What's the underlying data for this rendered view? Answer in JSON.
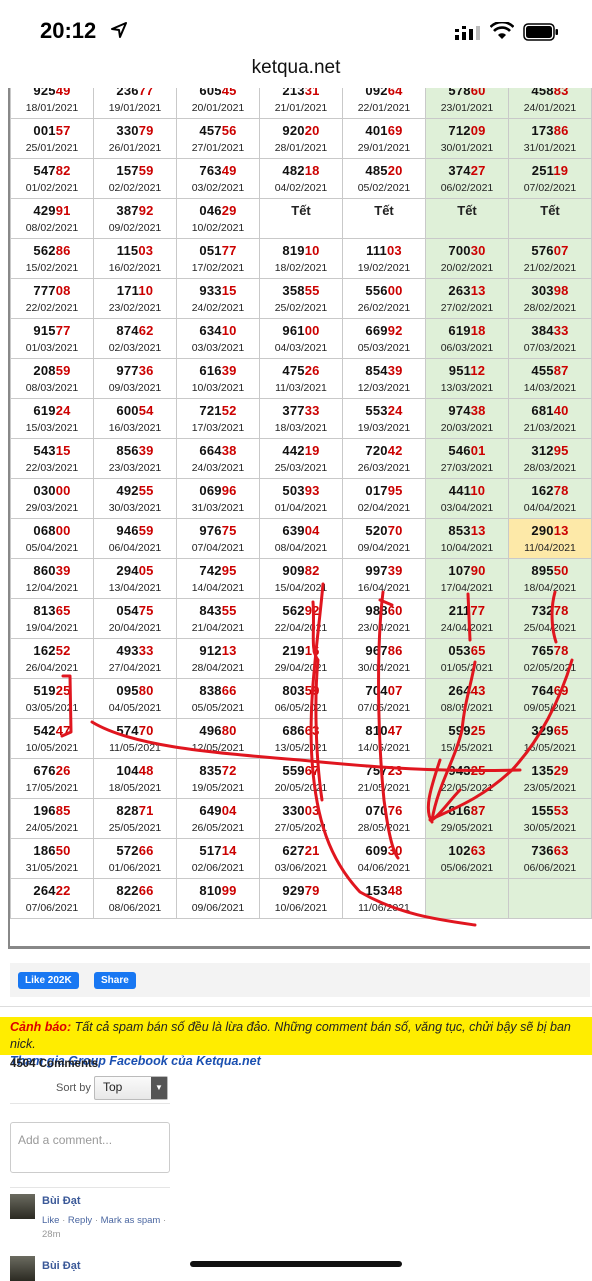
{
  "status_bar": {
    "time": "20:12"
  },
  "browser": {
    "url": "ketqua.net"
  },
  "results_table": {
    "weeks": [
      [
        {
          "num": "92549",
          "date": "18/01/2021"
        },
        {
          "num": "23677",
          "date": "19/01/2021"
        },
        {
          "num": "60545",
          "date": "20/01/2021"
        },
        {
          "num": "21331",
          "date": "21/01/2021"
        },
        {
          "num": "09264",
          "date": "22/01/2021"
        },
        {
          "num": "57860",
          "date": "23/01/2021"
        },
        {
          "num": "45883",
          "date": "24/01/2021"
        }
      ],
      [
        {
          "num": "00157",
          "date": "25/01/2021"
        },
        {
          "num": "33079",
          "date": "26/01/2021"
        },
        {
          "num": "45756",
          "date": "27/01/2021"
        },
        {
          "num": "92020",
          "date": "28/01/2021"
        },
        {
          "num": "40169",
          "date": "29/01/2021"
        },
        {
          "num": "71209",
          "date": "30/01/2021"
        },
        {
          "num": "17386",
          "date": "31/01/2021"
        }
      ],
      [
        {
          "num": "54782",
          "date": "01/02/2021"
        },
        {
          "num": "15759",
          "date": "02/02/2021"
        },
        {
          "num": "76349",
          "date": "03/02/2021"
        },
        {
          "num": "48218",
          "date": "04/02/2021"
        },
        {
          "num": "48520",
          "date": "05/02/2021"
        },
        {
          "num": "37427",
          "date": "06/02/2021"
        },
        {
          "num": "25119",
          "date": "07/02/2021"
        }
      ],
      [
        {
          "num": "42991",
          "date": "08/02/2021"
        },
        {
          "num": "38792",
          "date": "09/02/2021"
        },
        {
          "num": "04629",
          "date": "10/02/2021"
        },
        {
          "tet": "Tết"
        },
        {
          "tet": "Tết"
        },
        {
          "tet": "Tết"
        },
        {
          "tet": "Tết"
        }
      ],
      [
        {
          "num": "56286",
          "date": "15/02/2021"
        },
        {
          "num": "11503",
          "date": "16/02/2021"
        },
        {
          "num": "05177",
          "date": "17/02/2021"
        },
        {
          "num": "81910",
          "date": "18/02/2021"
        },
        {
          "num": "11103",
          "date": "19/02/2021"
        },
        {
          "num": "70030",
          "date": "20/02/2021"
        },
        {
          "num": "57607",
          "date": "21/02/2021"
        }
      ],
      [
        {
          "num": "77708",
          "date": "22/02/2021"
        },
        {
          "num": "17110",
          "date": "23/02/2021"
        },
        {
          "num": "93315",
          "date": "24/02/2021"
        },
        {
          "num": "35855",
          "date": "25/02/2021"
        },
        {
          "num": "55600",
          "date": "26/02/2021"
        },
        {
          "num": "26313",
          "date": "27/02/2021"
        },
        {
          "num": "30398",
          "date": "28/02/2021"
        }
      ],
      [
        {
          "num": "91577",
          "date": "01/03/2021"
        },
        {
          "num": "87462",
          "date": "02/03/2021"
        },
        {
          "num": "63410",
          "date": "03/03/2021"
        },
        {
          "num": "96100",
          "date": "04/03/2021"
        },
        {
          "num": "66992",
          "date": "05/03/2021"
        },
        {
          "num": "61918",
          "date": "06/03/2021"
        },
        {
          "num": "38433",
          "date": "07/03/2021"
        }
      ],
      [
        {
          "num": "20859",
          "date": "08/03/2021"
        },
        {
          "num": "97736",
          "date": "09/03/2021"
        },
        {
          "num": "61639",
          "date": "10/03/2021"
        },
        {
          "num": "47526",
          "date": "11/03/2021"
        },
        {
          "num": "85439",
          "date": "12/03/2021"
        },
        {
          "num": "95112",
          "date": "13/03/2021"
        },
        {
          "num": "45587",
          "date": "14/03/2021"
        }
      ],
      [
        {
          "num": "61924",
          "date": "15/03/2021"
        },
        {
          "num": "60054",
          "date": "16/03/2021"
        },
        {
          "num": "72152",
          "date": "17/03/2021"
        },
        {
          "num": "37733",
          "date": "18/03/2021"
        },
        {
          "num": "55324",
          "date": "19/03/2021"
        },
        {
          "num": "97438",
          "date": "20/03/2021"
        },
        {
          "num": "68140",
          "date": "21/03/2021"
        }
      ],
      [
        {
          "num": "54315",
          "date": "22/03/2021"
        },
        {
          "num": "85639",
          "date": "23/03/2021"
        },
        {
          "num": "66438",
          "date": "24/03/2021"
        },
        {
          "num": "44219",
          "date": "25/03/2021"
        },
        {
          "num": "72042",
          "date": "26/03/2021"
        },
        {
          "num": "54601",
          "date": "27/03/2021"
        },
        {
          "num": "31295",
          "date": "28/03/2021"
        }
      ],
      [
        {
          "num": "03000",
          "date": "29/03/2021"
        },
        {
          "num": "49255",
          "date": "30/03/2021"
        },
        {
          "num": "06996",
          "date": "31/03/2021"
        },
        {
          "num": "50393",
          "date": "01/04/2021"
        },
        {
          "num": "01795",
          "date": "02/04/2021"
        },
        {
          "num": "44110",
          "date": "03/04/2021"
        },
        {
          "num": "16278",
          "date": "04/04/2021"
        }
      ],
      [
        {
          "num": "06800",
          "date": "05/04/2021"
        },
        {
          "num": "94659",
          "date": "06/04/2021"
        },
        {
          "num": "97675",
          "date": "07/04/2021"
        },
        {
          "num": "63904",
          "date": "08/04/2021"
        },
        {
          "num": "52070",
          "date": "09/04/2021"
        },
        {
          "num": "85313",
          "date": "10/04/2021"
        },
        {
          "num": "29013",
          "date": "11/04/2021"
        }
      ],
      [
        {
          "num": "86039",
          "date": "12/04/2021"
        },
        {
          "num": "29405",
          "date": "13/04/2021"
        },
        {
          "num": "74295",
          "date": "14/04/2021"
        },
        {
          "num": "90982",
          "date": "15/04/2021"
        },
        {
          "num": "99739",
          "date": "16/04/2021"
        },
        {
          "num": "10790",
          "date": "17/04/2021"
        },
        {
          "num": "89550",
          "date": "18/04/2021"
        }
      ],
      [
        {
          "num": "81365",
          "date": "19/04/2021"
        },
        {
          "num": "05475",
          "date": "20/04/2021"
        },
        {
          "num": "84355",
          "date": "21/04/2021"
        },
        {
          "num": "56292",
          "date": "22/04/2021"
        },
        {
          "num": "98860",
          "date": "23/04/2021"
        },
        {
          "num": "21177",
          "date": "24/04/2021"
        },
        {
          "num": "73278",
          "date": "25/04/2021"
        }
      ],
      [
        {
          "num": "16252",
          "date": "26/04/2021"
        },
        {
          "num": "49333",
          "date": "27/04/2021"
        },
        {
          "num": "91213",
          "date": "28/04/2021"
        },
        {
          "num": "21916",
          "date": "29/04/2021"
        },
        {
          "num": "96786",
          "date": "30/04/2021"
        },
        {
          "num": "05365",
          "date": "01/05/2021"
        },
        {
          "num": "76578",
          "date": "02/05/2021"
        }
      ],
      [
        {
          "num": "51925",
          "date": "03/05/2021"
        },
        {
          "num": "09580",
          "date": "04/05/2021"
        },
        {
          "num": "83866",
          "date": "05/05/2021"
        },
        {
          "num": "80359",
          "date": "06/05/2021"
        },
        {
          "num": "70407",
          "date": "07/05/2021"
        },
        {
          "num": "26443",
          "date": "08/05/2021"
        },
        {
          "num": "76469",
          "date": "09/05/2021"
        }
      ],
      [
        {
          "num": "54247",
          "date": "10/05/2021"
        },
        {
          "num": "57470",
          "date": "11/05/2021"
        },
        {
          "num": "49680",
          "date": "12/05/2021"
        },
        {
          "num": "68663",
          "date": "13/05/2021"
        },
        {
          "num": "81047",
          "date": "14/05/2021"
        },
        {
          "num": "59925",
          "date": "15/05/2021"
        },
        {
          "num": "32965",
          "date": "16/05/2021"
        }
      ],
      [
        {
          "num": "67626",
          "date": "17/05/2021"
        },
        {
          "num": "10448",
          "date": "18/05/2021"
        },
        {
          "num": "83572",
          "date": "19/05/2021"
        },
        {
          "num": "55967",
          "date": "20/05/2021"
        },
        {
          "num": "75723",
          "date": "21/05/2021"
        },
        {
          "num": "94325",
          "date": "22/05/2021"
        },
        {
          "num": "13529",
          "date": "23/05/2021"
        }
      ],
      [
        {
          "num": "19685",
          "date": "24/05/2021"
        },
        {
          "num": "82871",
          "date": "25/05/2021"
        },
        {
          "num": "64904",
          "date": "26/05/2021"
        },
        {
          "num": "33003",
          "date": "27/05/2021"
        },
        {
          "num": "07076",
          "date": "28/05/2021"
        },
        {
          "num": "81687",
          "date": "29/05/2021"
        },
        {
          "num": "15553",
          "date": "30/05/2021"
        }
      ],
      [
        {
          "num": "18650",
          "date": "31/05/2021"
        },
        {
          "num": "57266",
          "date": "01/06/2021"
        },
        {
          "num": "51714",
          "date": "02/06/2021"
        },
        {
          "num": "62721",
          "date": "03/06/2021"
        },
        {
          "num": "60930",
          "date": "04/06/2021"
        },
        {
          "num": "10263",
          "date": "05/06/2021"
        },
        {
          "num": "73663",
          "date": "06/06/2021"
        }
      ],
      [
        {
          "num": "26422",
          "date": "07/06/2021"
        },
        {
          "num": "82266",
          "date": "08/06/2021"
        },
        {
          "num": "81099",
          "date": "09/06/2021"
        },
        {
          "num": "92979",
          "date": "10/06/2021"
        },
        {
          "num": "15348",
          "date": "11/06/2021"
        },
        {
          "empty": true
        },
        {
          "empty": true
        }
      ]
    ],
    "highlight_date": "11/04/2021",
    "colors": {
      "weekend_bg": "#dff0d8",
      "today_bg": "#fde9a8",
      "digit_red": "#cc0000"
    }
  },
  "social": {
    "like_label": "Like 202K",
    "share_label": "Share"
  },
  "notice": {
    "label": "Cảnh báo:",
    "text": "Tất cả spam bán số đều là lừa đảo. Những comment bán số, văng tục, chửi bậy sẽ bị ban nick.",
    "group_link": "Tham gia Group Facebook của Ketqua.net"
  },
  "comments": {
    "count": "4504 Comments",
    "sort_label": "Sort by",
    "sort_value": "Top",
    "placeholder": "Add a comment...",
    "items": [
      {
        "author": "Bùi Đạt",
        "like": "Like",
        "reply": "Reply",
        "spam": "Mark as spam",
        "time": "28m"
      },
      {
        "author": "Bùi Đạt"
      }
    ]
  }
}
